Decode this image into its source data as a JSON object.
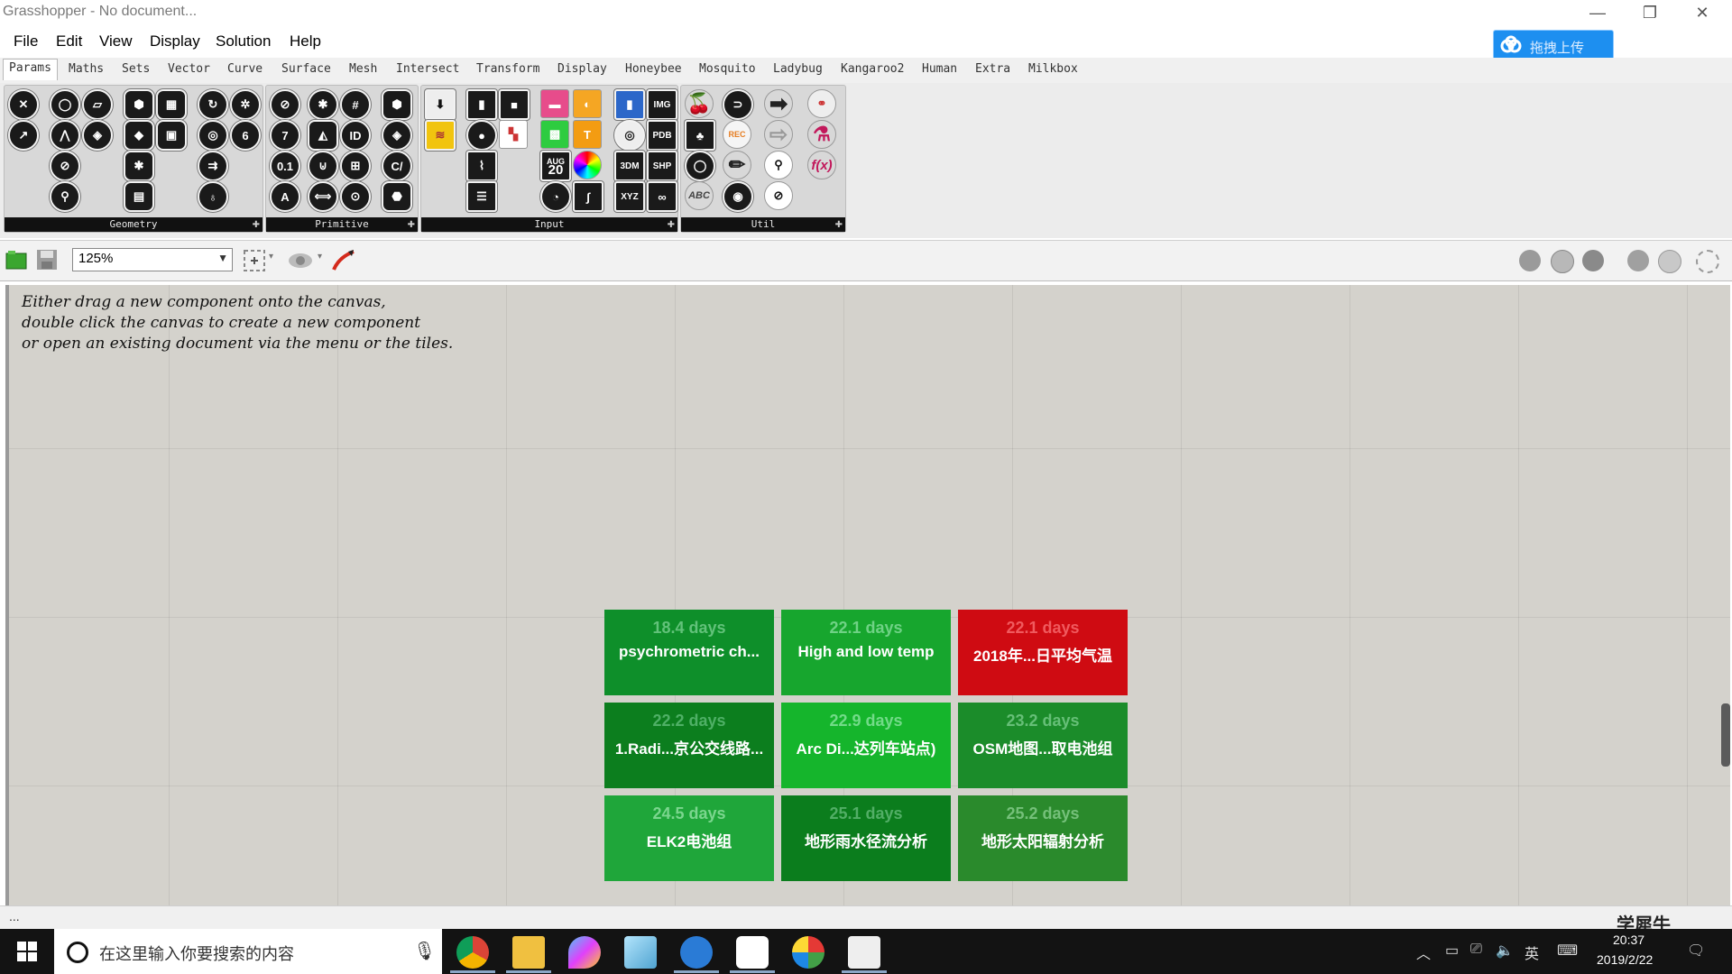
{
  "window": {
    "title": "Grasshopper - No document...",
    "minimize": "—",
    "restore": "❐",
    "close": "✕",
    "upload_label": "拖拽上传"
  },
  "menu": [
    "File",
    "Edit",
    "View",
    "Display",
    "Solution",
    "Help"
  ],
  "tabs": [
    "Params",
    "Maths",
    "Sets",
    "Vector",
    "Curve",
    "Surface",
    "Mesh",
    "Intersect",
    "Transform",
    "Display",
    "Honeybee",
    "Mosquito",
    "Ladybug",
    "Kangaroo2",
    "Human",
    "Extra",
    "Milkbox"
  ],
  "active_tab": "Params",
  "panels": {
    "geometry": "Geometry",
    "primitive": "Primitive",
    "input": "Input",
    "util": "Util"
  },
  "icon_labels": {
    "id": "ID",
    "seven": "7",
    "zero_one": "0.1",
    "a": "A",
    "c": "C/",
    "img": "IMG",
    "pdb": "PDB",
    "three_dm": "3DM",
    "shp": "SHP",
    "xyz": "XYZ",
    "aug": "AUG",
    "twenty": "20",
    "fx": "f(x)",
    "abc": "ABC",
    "rec": "REC"
  },
  "toolbar": {
    "zoom": "125%"
  },
  "canvas": {
    "hint_lines": [
      "Either drag a new component onto the canvas,",
      "double click the canvas to create a new component",
      "or open an existing document via the menu or the tiles."
    ]
  },
  "tiles": [
    {
      "days": "18.4 days",
      "name": "psychrometric ch...",
      "bg": "#0e8f2a",
      "days_color": "#62c27a"
    },
    {
      "days": "22.1 days",
      "name": "High and low temp",
      "bg": "#17a62e",
      "days_color": "#6fd285"
    },
    {
      "days": "22.1 days",
      "name": "2018年...日平均气温",
      "bg": "#cf0b12",
      "days_color": "#f05a5e"
    },
    {
      "days": "22.2 days",
      "name": "1.Radi...京公交线路...",
      "bg": "#0c7e1e",
      "days_color": "#4fb066"
    },
    {
      "days": "22.9 days",
      "name": "Arc Di...达列车站点)",
      "bg": "#15b52c",
      "days_color": "#72db88"
    },
    {
      "days": "23.2 days",
      "name": "OSM地图...取电池组",
      "bg": "#1b8c2a",
      "days_color": "#66bf77"
    },
    {
      "days": "24.5 days",
      "name": "ELK2电池组",
      "bg": "#1fa63a",
      "days_color": "#7bd68e"
    },
    {
      "days": "25.1 days",
      "name": "地形雨水径流分析",
      "bg": "#0b7d1d",
      "days_color": "#52ae66"
    },
    {
      "days": "25.2 days",
      "name": "地形太阳辐射分析",
      "bg": "#2a8a2c",
      "days_color": "#75c07a"
    }
  ],
  "status": {
    "text": "...",
    "watermark": "学犀牛"
  },
  "taskbar": {
    "search_placeholder": "在这里输入你要搜索的内容",
    "ime": "英",
    "time": "20:37",
    "date": "2019/2/22"
  }
}
